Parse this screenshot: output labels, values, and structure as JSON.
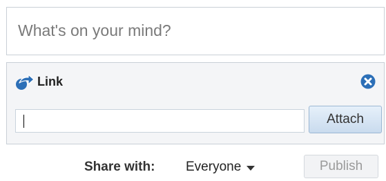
{
  "status": {
    "placeholder": "What's on your mind?"
  },
  "link_panel": {
    "title": "Link",
    "icon": "share-arrow-icon",
    "close_icon": "close-icon",
    "input_value": "",
    "attach_label": "Attach"
  },
  "footer": {
    "share_label": "Share with:",
    "share_value": "Everyone",
    "publish_label": "Publish"
  },
  "colors": {
    "accent": "#2c6fb7",
    "attach_bg": "#d6e4f3",
    "publish_disabled_text": "#9a9a9a"
  }
}
